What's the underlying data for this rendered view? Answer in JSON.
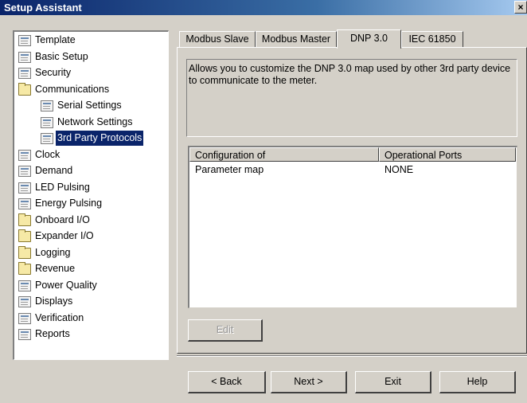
{
  "window": {
    "title": "Setup Assistant",
    "close_glyph": "×"
  },
  "tree": {
    "items": [
      {
        "label": "Template",
        "icon": "doc"
      },
      {
        "label": "Basic Setup",
        "icon": "doc"
      },
      {
        "label": "Security",
        "icon": "doc"
      },
      {
        "label": "Communications",
        "icon": "folder"
      },
      {
        "label": "Serial Settings",
        "icon": "doc",
        "indent": 1
      },
      {
        "label": "Network Settings",
        "icon": "doc",
        "indent": 1
      },
      {
        "label": "3rd Party Protocols",
        "icon": "doc",
        "indent": 1,
        "selected": true
      },
      {
        "label": "Clock",
        "icon": "doc"
      },
      {
        "label": "Demand",
        "icon": "doc"
      },
      {
        "label": "LED Pulsing",
        "icon": "doc"
      },
      {
        "label": "Energy Pulsing",
        "icon": "doc"
      },
      {
        "label": "Onboard I/O",
        "icon": "folder"
      },
      {
        "label": "Expander I/O",
        "icon": "folder"
      },
      {
        "label": "Logging",
        "icon": "folder"
      },
      {
        "label": "Revenue",
        "icon": "folder"
      },
      {
        "label": "Power Quality",
        "icon": "doc"
      },
      {
        "label": "Displays",
        "icon": "doc"
      },
      {
        "label": "Verification",
        "icon": "doc"
      },
      {
        "label": "Reports",
        "icon": "doc"
      }
    ]
  },
  "tabs": [
    {
      "label": "Modbus Slave"
    },
    {
      "label": "Modbus Master"
    },
    {
      "label": "DNP 3.0",
      "active": true
    },
    {
      "label": "IEC 61850"
    }
  ],
  "description": "Allows you to customize the DNP 3.0 map used by other 3rd party device to communicate to the meter.",
  "table": {
    "columns": [
      "Configuration of",
      "Operational Ports"
    ],
    "rows": [
      [
        "Parameter map",
        "NONE"
      ]
    ]
  },
  "buttons": {
    "edit": "Edit",
    "back": "< Back",
    "next": "Next >",
    "exit": "Exit",
    "help": "Help"
  }
}
